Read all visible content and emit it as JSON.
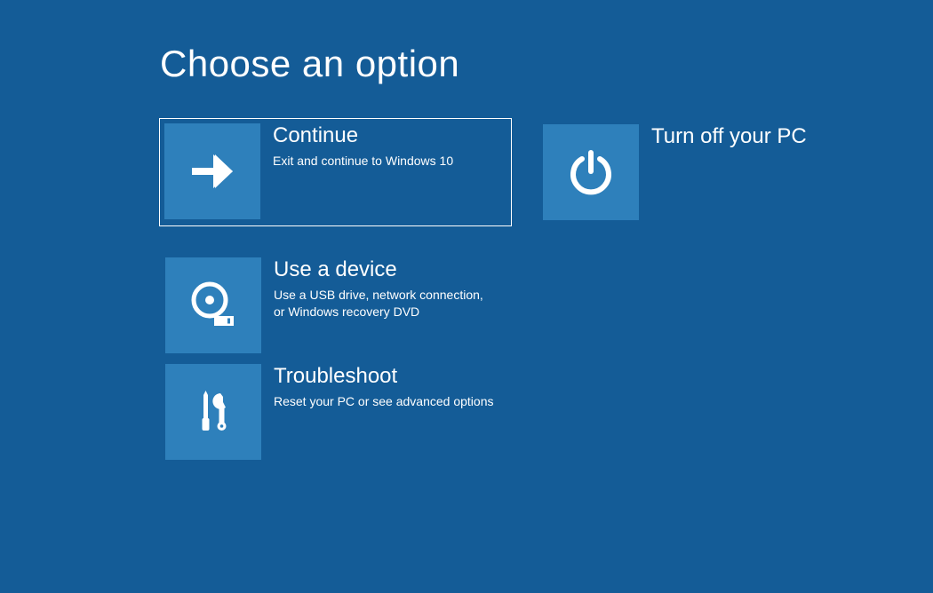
{
  "page": {
    "title": "Choose an option"
  },
  "options": {
    "continue": {
      "title": "Continue",
      "description": "Exit and continue to Windows 10"
    },
    "turnoff": {
      "title": "Turn off your PC",
      "description": ""
    },
    "usedevice": {
      "title": "Use a device",
      "description": "Use a USB drive, network connection, or Windows recovery DVD"
    },
    "troubleshoot": {
      "title": "Troubleshoot",
      "description": "Reset your PC or see advanced options"
    }
  },
  "colors": {
    "background": "#145c97",
    "tile": "#2e80bb",
    "text": "#ffffff"
  }
}
